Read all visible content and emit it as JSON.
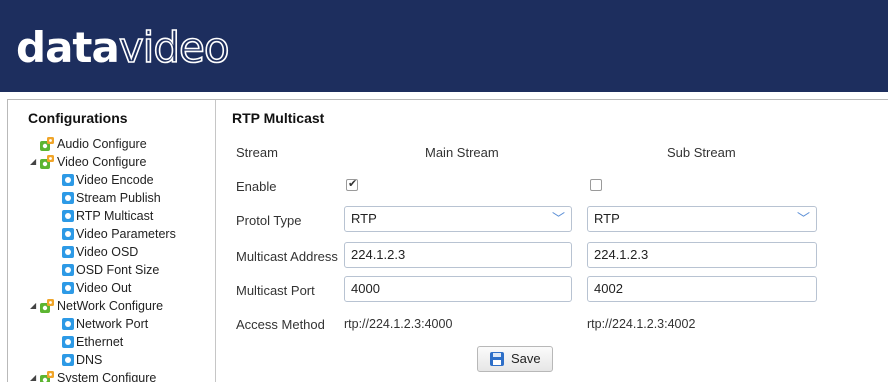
{
  "brand": {
    "logo_bold": "data",
    "logo_light": "video"
  },
  "sidebar": {
    "title": "Configurations",
    "items": [
      {
        "label": "Audio Configure",
        "level": 1,
        "icon": "gear-group-icon"
      },
      {
        "label": "Video Configure",
        "level": 1,
        "icon": "gear-group-icon",
        "expanded": true
      },
      {
        "label": "Video Encode",
        "level": 2,
        "icon": "gear-icon"
      },
      {
        "label": "Stream Publish",
        "level": 2,
        "icon": "gear-icon"
      },
      {
        "label": "RTP Multicast",
        "level": 2,
        "icon": "gear-icon",
        "selected": true
      },
      {
        "label": "Video Parameters",
        "level": 2,
        "icon": "gear-icon"
      },
      {
        "label": "Video OSD",
        "level": 2,
        "icon": "gear-icon"
      },
      {
        "label": "OSD Font Size",
        "level": 2,
        "icon": "gear-icon"
      },
      {
        "label": "Video Out",
        "level": 2,
        "icon": "gear-icon"
      },
      {
        "label": "NetWork Configure",
        "level": 1,
        "icon": "gear-group-icon",
        "expanded": true
      },
      {
        "label": "Network Port",
        "level": 2,
        "icon": "gear-icon"
      },
      {
        "label": "Ethernet",
        "level": 2,
        "icon": "gear-icon"
      },
      {
        "label": "DNS",
        "level": 2,
        "icon": "gear-icon"
      },
      {
        "label": "System Configure",
        "level": 1,
        "icon": "gear-group-icon",
        "expanded": true
      }
    ]
  },
  "panel": {
    "title": "RTP Multicast",
    "labels": {
      "stream": "Stream",
      "enable": "Enable",
      "protocol": "Protol Type",
      "address": "Multicast Address",
      "port": "Multicast Port",
      "access": "Access Method"
    },
    "main": {
      "header": "Main Stream",
      "enabled": true,
      "protocol": "RTP",
      "address": "224.1.2.3",
      "port": "4000",
      "access": "rtp://224.1.2.3:4000"
    },
    "sub": {
      "header": "Sub Stream",
      "enabled": false,
      "protocol": "RTP",
      "address": "224.1.2.3",
      "port": "4002",
      "access": "rtp://224.1.2.3:4002"
    },
    "save_label": "Save"
  },
  "colors": {
    "header_bg": "#1d2e5e",
    "selected_bg": "#fbdc86",
    "icon_blue": "#2d9ae6",
    "icon_green": "#5cb531"
  }
}
